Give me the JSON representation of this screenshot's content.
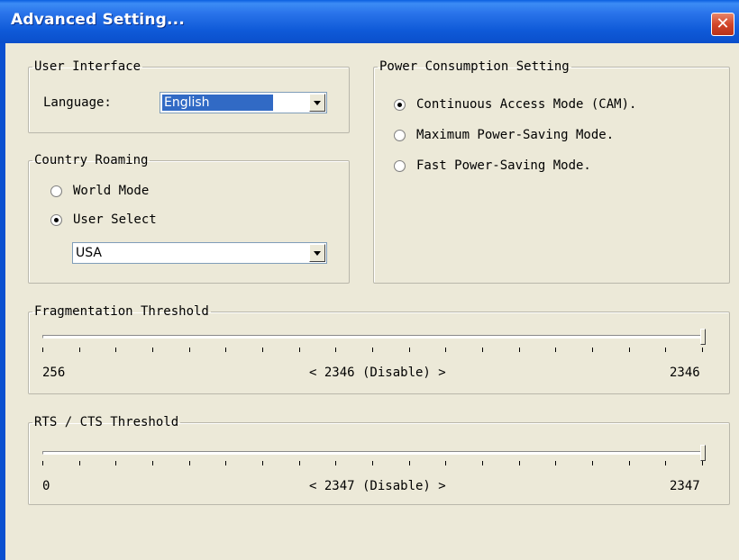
{
  "window": {
    "title": "Advanced Setting...",
    "close_icon": "close-icon"
  },
  "user_interface": {
    "legend": "User Interface",
    "language_label": "Language:",
    "language_value": "English"
  },
  "country_roaming": {
    "legend": "Country Roaming",
    "options": [
      "World Mode",
      "User Select"
    ],
    "selected": "User Select",
    "country_value": "USA"
  },
  "power": {
    "legend": "Power Consumption Setting",
    "options": [
      "Continuous Access Mode (CAM).",
      "Maximum Power-Saving Mode.",
      "Fast Power-Saving Mode."
    ],
    "selected": "Continuous Access Mode (CAM)."
  },
  "fragmentation": {
    "legend": "Fragmentation Threshold",
    "min": "256",
    "current": "< 2346 (Disable) >",
    "max": "2346",
    "value_fraction": 1.0
  },
  "rts_cts": {
    "legend": "RTS / CTS Threshold",
    "min": "0",
    "current": "< 2347 (Disable) >",
    "max": "2347",
    "value_fraction": 1.0
  },
  "colors": {
    "titlebar": "#0a5fe0",
    "face": "#ece9d8",
    "selection": "#316ac5"
  }
}
